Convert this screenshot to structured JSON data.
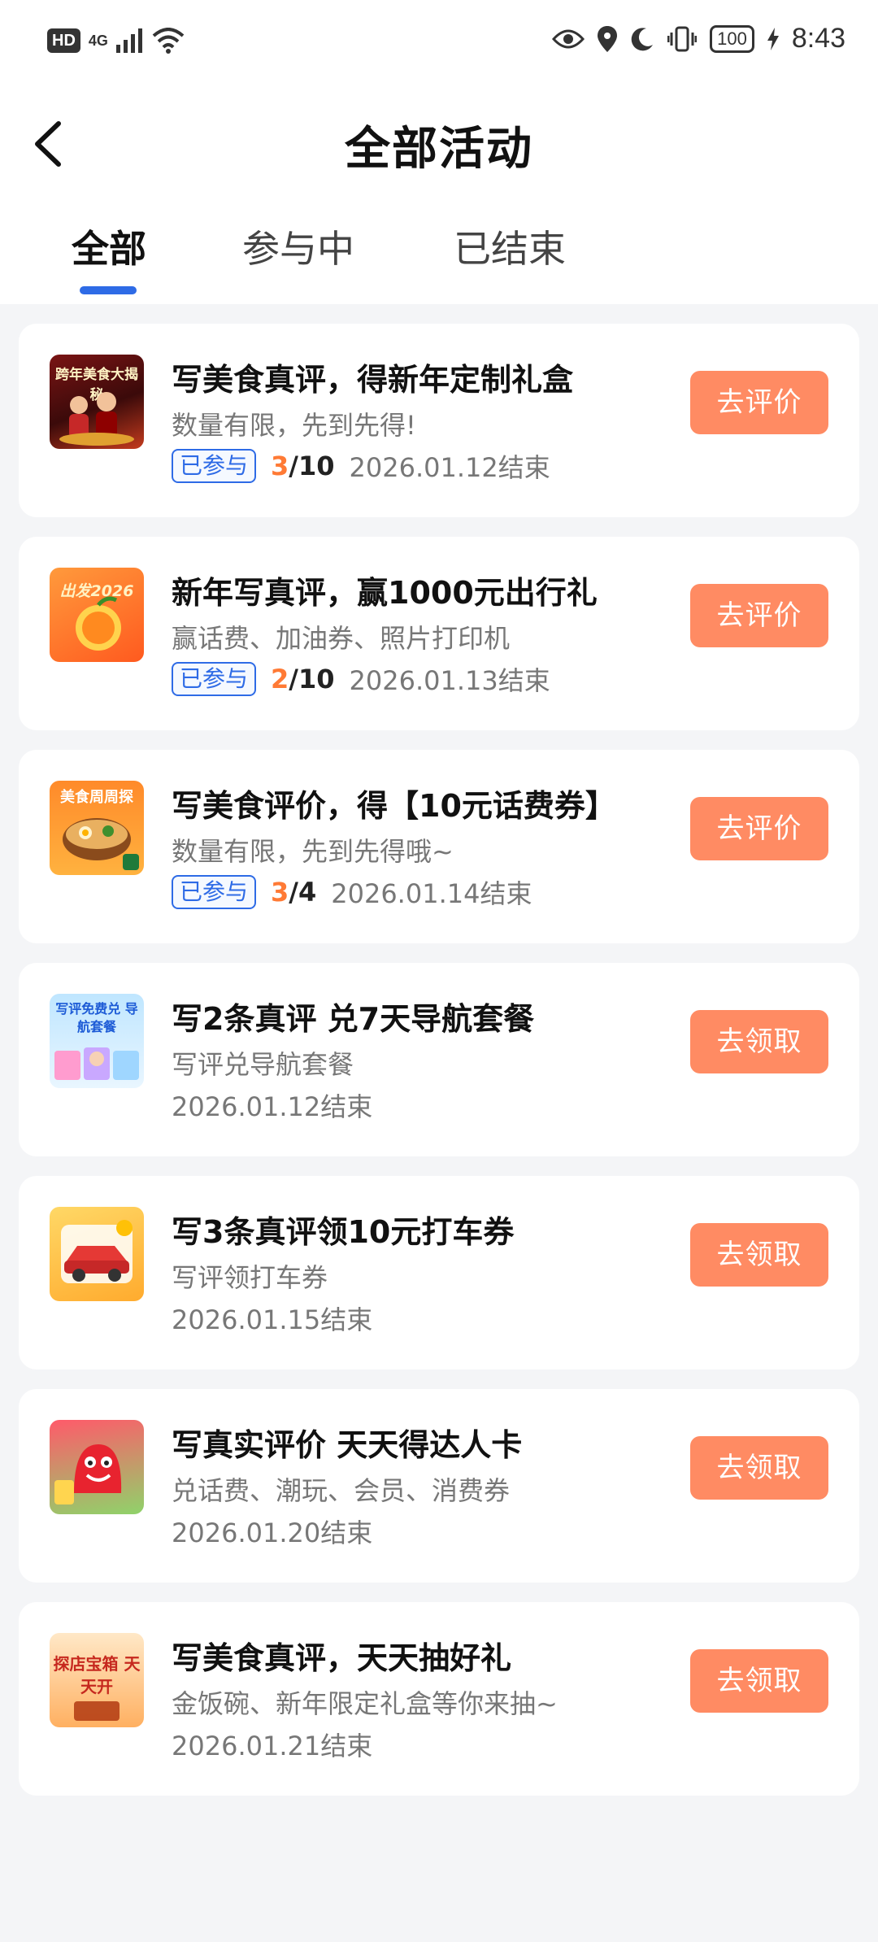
{
  "status": {
    "hd": "HD",
    "network": "4G",
    "battery": "100",
    "time": "8:43"
  },
  "nav": {
    "title": "全部活动"
  },
  "tabs": [
    {
      "label": "全部",
      "active": true
    },
    {
      "label": "参与中",
      "active": false
    },
    {
      "label": "已结束",
      "active": false
    }
  ],
  "cards": [
    {
      "title": "写美食真评，得新年定制礼盒",
      "subtitle": "数量有限，先到先得!",
      "badge": "已参与",
      "progress_done": "3",
      "progress_total": "/10",
      "date": "2026.01.12结束",
      "button": "去评价",
      "thumb_text": "跨年美食大揭秘"
    },
    {
      "title": "新年写真评，赢1000元出行礼",
      "subtitle": "赢话费、加油券、照片打印机",
      "badge": "已参与",
      "progress_done": "2",
      "progress_total": "/10",
      "date": "2026.01.13结束",
      "button": "去评价",
      "thumb_text": "出发2026"
    },
    {
      "title": "写美食评价，得【10元话费券】",
      "subtitle": "数量有限，先到先得哦~",
      "badge": "已参与",
      "progress_done": "3",
      "progress_total": "/4",
      "date": "2026.01.14结束",
      "button": "去评价",
      "thumb_text": "美食周周探"
    },
    {
      "title": "写2条真评 兑7天导航套餐",
      "subtitle": "写评兑导航套餐",
      "date": "2026.01.12结束",
      "button": "去领取",
      "thumb_text": "写评免费兑 导航套餐"
    },
    {
      "title": "写3条真评领10元打车券",
      "subtitle": "写评领打车券",
      "date": "2026.01.15结束",
      "button": "去领取",
      "thumb_text": ""
    },
    {
      "title": "写真实评价 天天得达人卡",
      "subtitle": "兑话费、潮玩、会员、消费券",
      "date": "2026.01.20结束",
      "button": "去领取",
      "thumb_text": ""
    },
    {
      "title": "写美食真评，天天抽好礼",
      "subtitle": "金饭碗、新年限定礼盒等你来抽~",
      "date": "2026.01.21结束",
      "button": "去领取",
      "thumb_text": "探店宝箱 天天开"
    }
  ],
  "colors": {
    "accent_blue": "#2e6be6",
    "button_orange": "#ff8b63",
    "progress_orange": "#ff7a35",
    "page_bg": "#f4f5f7"
  }
}
